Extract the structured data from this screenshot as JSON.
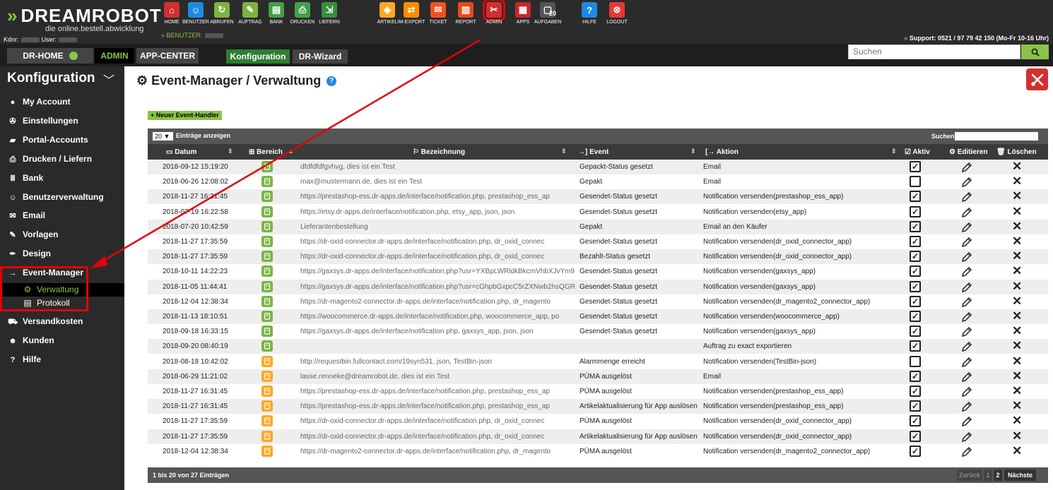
{
  "app": {
    "logo_prefix": "»",
    "logo_name": "DREAMROBOT",
    "logo_tagline": "die online.bestell.abwicklung",
    "kdnr_label": "Kdnr:",
    "user_label": "User:",
    "benutzer_label": "» BENUTZER:",
    "support_prefix": "»",
    "support_text": "Support: 0521 / 97 79 42 150 (Mo-Fr 10-16 Uhr)"
  },
  "colors": {
    "accent": "#8bc34a",
    "danger": "#e3000b",
    "dark": "#2b2b2b"
  },
  "topnav": [
    {
      "label": "HOME",
      "icon": "home-icon",
      "color": "#d32f2f",
      "glyph": "⌂"
    },
    {
      "label": "BENUTZER",
      "icon": "users-icon",
      "color": "#1e88e5",
      "glyph": "☺"
    },
    {
      "label": "ABRUFEN",
      "icon": "download-icon",
      "color": "#7cb342",
      "glyph": "↻"
    },
    {
      "label": "AUFTRAG",
      "icon": "order-icon",
      "color": "#7cb342",
      "glyph": "✎"
    },
    {
      "label": "BANK",
      "icon": "bank-icon",
      "color": "#43a047",
      "glyph": "▤"
    },
    {
      "label": "DRUCKEN",
      "icon": "printer-icon",
      "color": "#43a047",
      "glyph": "⎙"
    },
    {
      "label": "LIEFERN",
      "icon": "delivery-icon",
      "color": "#388e3c",
      "glyph": "⇲"
    },
    {
      "label": "ARTIKEL",
      "icon": "article-icon",
      "color": "#ffa726",
      "glyph": "◈"
    },
    {
      "label": "IM-EXPORT",
      "icon": "import-export-icon",
      "color": "#fb8c00",
      "glyph": "⇄"
    },
    {
      "label": "TICKET",
      "icon": "ticket-icon",
      "color": "#f4511e",
      "glyph": "✉"
    },
    {
      "label": "REPORT",
      "icon": "report-icon",
      "color": "#e64a19",
      "glyph": "▥"
    },
    {
      "label": "ADMIN",
      "icon": "admin-icon",
      "color": "#d32f2f",
      "glyph": "✂",
      "active": true
    },
    {
      "label": "APPS",
      "icon": "apps-icon",
      "color": "#c62828",
      "glyph": "▦"
    },
    {
      "label": "AUFGABEN",
      "icon": "tasks-icon",
      "color": "#555555",
      "glyph": "▢",
      "badge": "20"
    },
    {
      "label": "HILFE",
      "icon": "help-icon",
      "color": "#1e88e5",
      "glyph": "?"
    },
    {
      "label": "LOGOUT",
      "icon": "logout-icon",
      "color": "#e53935",
      "glyph": "⊗"
    }
  ],
  "navbar": {
    "home": "DR-HOME",
    "admin": "ADMIN",
    "appcenter": "APP-CENTER",
    "konfiguration": "Konfiguration",
    "wizard": "DR-Wizard",
    "search_placeholder": "Suchen"
  },
  "sidebar": {
    "title": "Konfiguration",
    "items": [
      {
        "label": "My Account",
        "icon": "account-icon",
        "glyph": "●"
      },
      {
        "label": "Einstellungen",
        "icon": "wrench-icon",
        "glyph": "✇"
      },
      {
        "label": "Portal-Accounts",
        "icon": "portal-icon",
        "glyph": "▰"
      },
      {
        "label": "Drucken / Liefern",
        "icon": "printer-icon",
        "glyph": "⎙"
      },
      {
        "label": "Bank",
        "icon": "bank-icon",
        "glyph": "Ⅲ"
      },
      {
        "label": "Benutzerverwaltung",
        "icon": "users-icon",
        "glyph": "☺"
      },
      {
        "label": "Email",
        "icon": "envelope-icon",
        "glyph": "✉"
      },
      {
        "label": "Vorlagen",
        "icon": "template-icon",
        "glyph": "✎"
      },
      {
        "label": "Design",
        "icon": "brush-icon",
        "glyph": "✒"
      },
      {
        "label": "Event-Manager",
        "icon": "sign-in-icon",
        "glyph": "→"
      },
      {
        "label": "Versandkosten",
        "icon": "truck-icon",
        "glyph": "⛟"
      },
      {
        "label": "Kunden",
        "icon": "user-icon",
        "glyph": "☻"
      },
      {
        "label": "Hilfe",
        "icon": "question-icon",
        "glyph": "?"
      }
    ],
    "sub": [
      {
        "label": "Verwaltung",
        "icon": "gear-icon",
        "glyph": "⚙"
      },
      {
        "label": "Protokoll",
        "icon": "list-icon",
        "glyph": "▤"
      }
    ]
  },
  "page": {
    "title": "Event-Manager / Verwaltung",
    "new_button": "+ Neuer Event-Handler",
    "length_value": "20 ▼",
    "length_label": "Einträge anzeigen",
    "search_label": "Suchen",
    "info": "1 bis 20 von 27 Einträgen",
    "pagination": {
      "prev": "Zurück",
      "p1": "1",
      "p2": "2",
      "next": "Nächste"
    }
  },
  "table": {
    "columns": {
      "datum": "Datum",
      "bereich": "Bereich",
      "bezeichnung": "Bezeichnung",
      "event": "→] Event",
      "aktion": "[→ Aktion",
      "aktiv": "Aktiv",
      "editieren": "Editieren",
      "loeschen": "Löschen"
    },
    "rows": [
      {
        "datum": "2018-09-12 15:19:20",
        "bereich": "order",
        "bez": "dfdfdfdfgvhvg, dies ist ein Test",
        "event": "Gepackt-Status gesetzt",
        "aktion": "Email",
        "aktiv": true
      },
      {
        "datum": "2018-06-26 12:08:02",
        "bereich": "order",
        "bez": "max@mustermann.de, dies ist ein Test",
        "event": "Gepakt",
        "aktion": "Email",
        "aktiv": false
      },
      {
        "datum": "2018-11-27 16:31:45",
        "bereich": "order",
        "bez": "https://prestashop-ess.dr-apps.de/interface/notification.php, prestashop_ess_ap",
        "event": "Gesendet-Status gesetzt",
        "aktion": "Notification versenden(prestashop_ess_app)",
        "aktiv": true
      },
      {
        "datum": "2018-07-19 16:22:58",
        "bereich": "order",
        "bez": "https://etsy.dr-apps.de/interface/notification.php, etsy_app, json, json",
        "event": "Gesendet-Status gesetzt",
        "aktion": "Notification versenden(etsy_app)",
        "aktiv": true
      },
      {
        "datum": "2018-07-20 10:42:59",
        "bereich": "order",
        "bez": "Lieferantenbestellung",
        "event": "Gepakt",
        "aktion": "Email an den Käufer",
        "aktiv": true
      },
      {
        "datum": "2018-11-27 17:35:59",
        "bereich": "order",
        "bez": "https://dr-oxid-connector.dr-apps.de/interface/notification.php, dr_oxid_connec",
        "event": "Gesendet-Status gesetzt",
        "aktion": "Notification versenden(dr_oxid_connector_app)",
        "aktiv": true
      },
      {
        "datum": "2018-11-27 17:35:59",
        "bereich": "order",
        "bez": "https://dr-oxid-connector.dr-apps.de/interface/notification.php, dr_oxid_connec",
        "event": "Bezahlt-Status gesetzt",
        "aktion": "Notification versenden(dr_oxid_connector_app)",
        "aktiv": true
      },
      {
        "datum": "2018-10-11 14:22:23",
        "bereich": "order",
        "bez": "https://gaxsys.dr-apps.de/interface/notification.php?usr=YXBpLWRldkBkcmVhbXJvYm9",
        "event": "Gesendet-Status gesetzt",
        "aktion": "Notification versenden(gaxsys_app)",
        "aktiv": true
      },
      {
        "datum": "2018-11-05 11:44:41",
        "bereich": "order",
        "bez": "https://gaxsys.dr-apps.de/interface/notification.php?usr=cGhpbGxpcC5rZXNwb2hsQGR",
        "event": "Gesendet-Status gesetzt",
        "aktion": "Notification versenden(gaxsys_app)",
        "aktiv": true
      },
      {
        "datum": "2018-12-04 12:38:34",
        "bereich": "order",
        "bez": "https://dr-magento2-connector.dr-apps.de/interface/notification.php, dr_magento",
        "event": "Gesendet-Status gesetzt",
        "aktion": "Notification versenden(dr_magento2_connector_app)",
        "aktiv": true
      },
      {
        "datum": "2018-11-13 18:10:51",
        "bereich": "order",
        "bez": "https://woocommerce.dr-apps.de/interface/notification.php, woocommerce_app, po",
        "event": "Gesendet-Status gesetzt",
        "aktion": "Notification versenden(woocommerce_app)",
        "aktiv": true
      },
      {
        "datum": "2018-09-18 16:33:15",
        "bereich": "order",
        "bez": "https://gaxsys.dr-apps.de/interface/notification.php, gaxsys_app, json, json",
        "event": "Gesendet-Status gesetzt",
        "aktion": "Notification versenden(gaxsys_app)",
        "aktiv": true
      },
      {
        "datum": "2018-09-20 08:40:19",
        "bereich": "order",
        "bez": "",
        "event": "",
        "aktion": "Auftrag zu exact exportieren",
        "aktiv": true
      },
      {
        "datum": "2018-08-18 10:42:02",
        "bereich": "article",
        "bez": "http://requestbin.fullcontact.com/19syn531, json, TestBin-json",
        "event": "Alarmmenge erreicht",
        "aktion": "Notification versenden(TestBin-json)",
        "aktiv": false
      },
      {
        "datum": "2018-06-29 11:21:02",
        "bereich": "article",
        "bez": "lasse.renneke@dreamrobot.de, dies ist ein Test",
        "event": "PÜMA ausgelöst",
        "aktion": "Email",
        "aktiv": true
      },
      {
        "datum": "2018-11-27 16:31:45",
        "bereich": "article",
        "bez": "https://prestashop-ess.dr-apps.de/interface/notification.php, prestashop_ess_ap",
        "event": "PÜMA ausgelöst",
        "aktion": "Notification versenden(prestashop_ess_app)",
        "aktiv": true
      },
      {
        "datum": "2018-11-27 16:31:45",
        "bereich": "article",
        "bez": "https://prestashop-ess.dr-apps.de/interface/notification.php, prestashop_ess_ap",
        "event": "Artikelaktualisierung für App auslösen",
        "aktion": "Notification versenden(prestashop_ess_app)",
        "aktiv": true
      },
      {
        "datum": "2018-11-27 17:35:59",
        "bereich": "article",
        "bez": "https://dr-oxid-connector.dr-apps.de/interface/notification.php, dr_oxid_connec",
        "event": "PÜMA ausgelöst",
        "aktion": "Notification versenden(dr_oxid_connector_app)",
        "aktiv": true
      },
      {
        "datum": "2018-11-27 17:35:59",
        "bereich": "article",
        "bez": "https://dr-oxid-connector.dr-apps.de/interface/notification.php, dr_oxid_connec",
        "event": "Artikelaktualisierung für App auslösen",
        "aktion": "Notification versenden(dr_oxid_connector_app)",
        "aktiv": true
      },
      {
        "datum": "2018-12-04 12:38:34",
        "bereich": "article",
        "bez": "https://dr-magento2-connector.dr-apps.de/interface/notification.php, dr_magento",
        "event": "PÜMA ausgelöst",
        "aktion": "Notification versenden(dr_magento2_connector_app)",
        "aktiv": true
      }
    ]
  }
}
